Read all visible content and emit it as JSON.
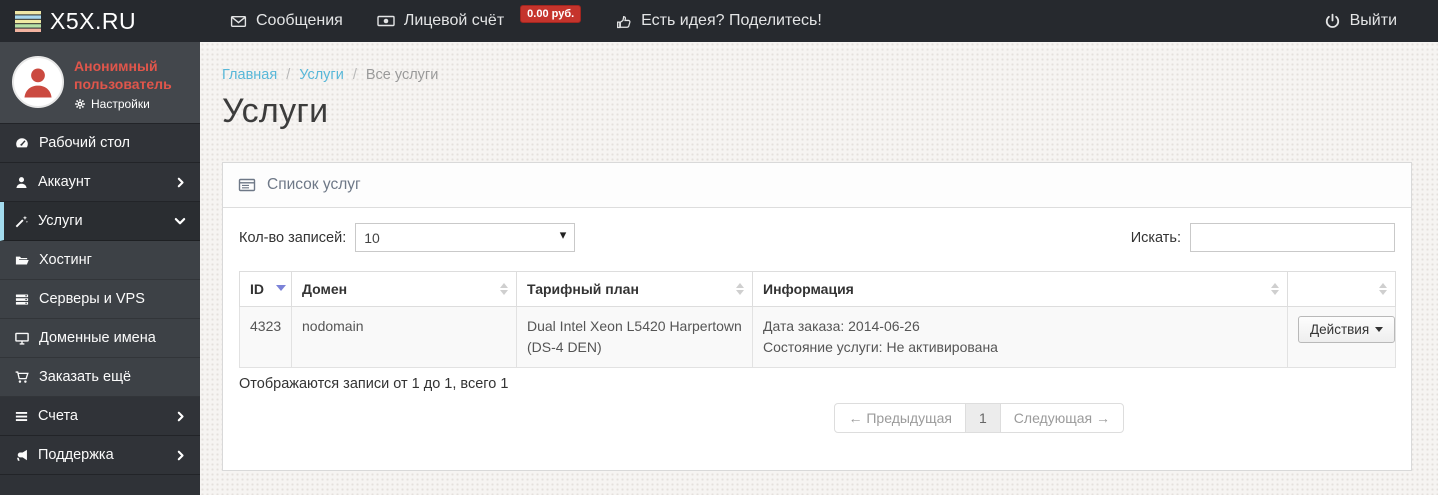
{
  "colors": {
    "brand_red": "#c5342c",
    "link_blue": "#58b7d8",
    "active_border": "#a3dbee",
    "user_name_red": "#e0564b"
  },
  "navbar": {
    "logo_text": "X5X.RU",
    "messages_label": "Сообщения",
    "account_label": "Лицевой счёт",
    "balance_badge": "0.00 руб.",
    "idea_label": "Есть идея? Поделитесь!",
    "logout_label": "Выйти"
  },
  "sidebar": {
    "user_name": "Анонимный пользователь",
    "settings_label": "Настройки",
    "menu": [
      {
        "label": "Рабочий стол"
      },
      {
        "label": "Аккаунт"
      },
      {
        "label": "Услуги"
      },
      {
        "label": "Хостинг"
      },
      {
        "label": "Серверы и VPS"
      },
      {
        "label": "Доменные имена"
      },
      {
        "label": "Заказать ещё"
      },
      {
        "label": "Счета"
      },
      {
        "label": "Поддержка"
      }
    ]
  },
  "breadcrumb": {
    "home": "Главная",
    "section": "Услуги",
    "current": "Все услуги"
  },
  "page_title": "Услуги",
  "panel": {
    "title": "Список услуг",
    "controls": {
      "length_label": "Кол-во записей:",
      "length_value": "10",
      "search_label": "Искать:"
    },
    "table": {
      "headers": {
        "id": "ID",
        "domain": "Домен",
        "plan": "Тарифный план",
        "info": "Информация"
      },
      "row": {
        "id": "4323",
        "domain": "nodomain",
        "plan": "Dual Intel Xeon L5420 Harpertown (DS-4 DEN)",
        "info_order_date": "Дата заказа: 2014-06-26",
        "info_status": "Состояние услуги: Не активирована",
        "action_label": "Действия"
      }
    },
    "footer": {
      "info": "Отображаются записи от 1 до 1, всего 1",
      "prev_label": "← Предыдущая",
      "page": "1",
      "next_label": "Следующая →"
    }
  }
}
